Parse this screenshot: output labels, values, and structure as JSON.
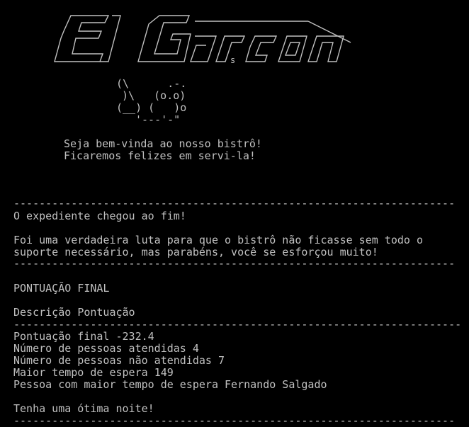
{
  "colors": {
    "background": "#000000",
    "text": "#c0c0c0"
  },
  "art": {
    "logo": "     ______   __        _______\n    / ____/  / /       / ____/ ___ _   ___ ___   ___   ___\n   / __/    / /       / / __  / _ `/ / __// __\\ / _ \\ / _ \\\n  / /___   / /       / /_/ / / /_/ / / /  / /_/ // // // // /\n /_____/  /_/        \\____/  \\__,_/ /_/   \\____/ \\___//_//_/",
    "cat": "          (\\       .-.\n           )\\    (o.o)\n          (__) (    )o\n              '---'-\""
  },
  "welcome": {
    "line1": "Seja bem-vinda ao nosso bistrô!",
    "line2": "Ficaremos felizes em servi-la!"
  },
  "separator": "---------------------------------------------------------------------",
  "separator_long": "----------------------------------------------------------------------",
  "messages": {
    "end_shift": "O expediente chegou ao fim!",
    "struggle1": "Foi uma verdadeira luta para que o bistrô não ficasse sem todo o",
    "struggle2": "suporte necessário, mas parabéns, você se esforçou muito!"
  },
  "score": {
    "heading": "PONTUAÇÃO FINAL",
    "header_desc": "Descrição",
    "header_score": "Pontuação",
    "rows": [
      {
        "desc": "Pontuação final",
        "value": "-232.4"
      },
      {
        "desc": "Número de pessoas atendidas",
        "value": "4"
      },
      {
        "desc": "Número de pessoas não atendidas",
        "value": "7"
      },
      {
        "desc": "Maior tempo de espera",
        "value": "149"
      },
      {
        "desc": "Pessoa com maior tempo de espera",
        "value": "Fernando Salgado"
      }
    ]
  },
  "goodbye": "Tenha uma ótima noite!"
}
